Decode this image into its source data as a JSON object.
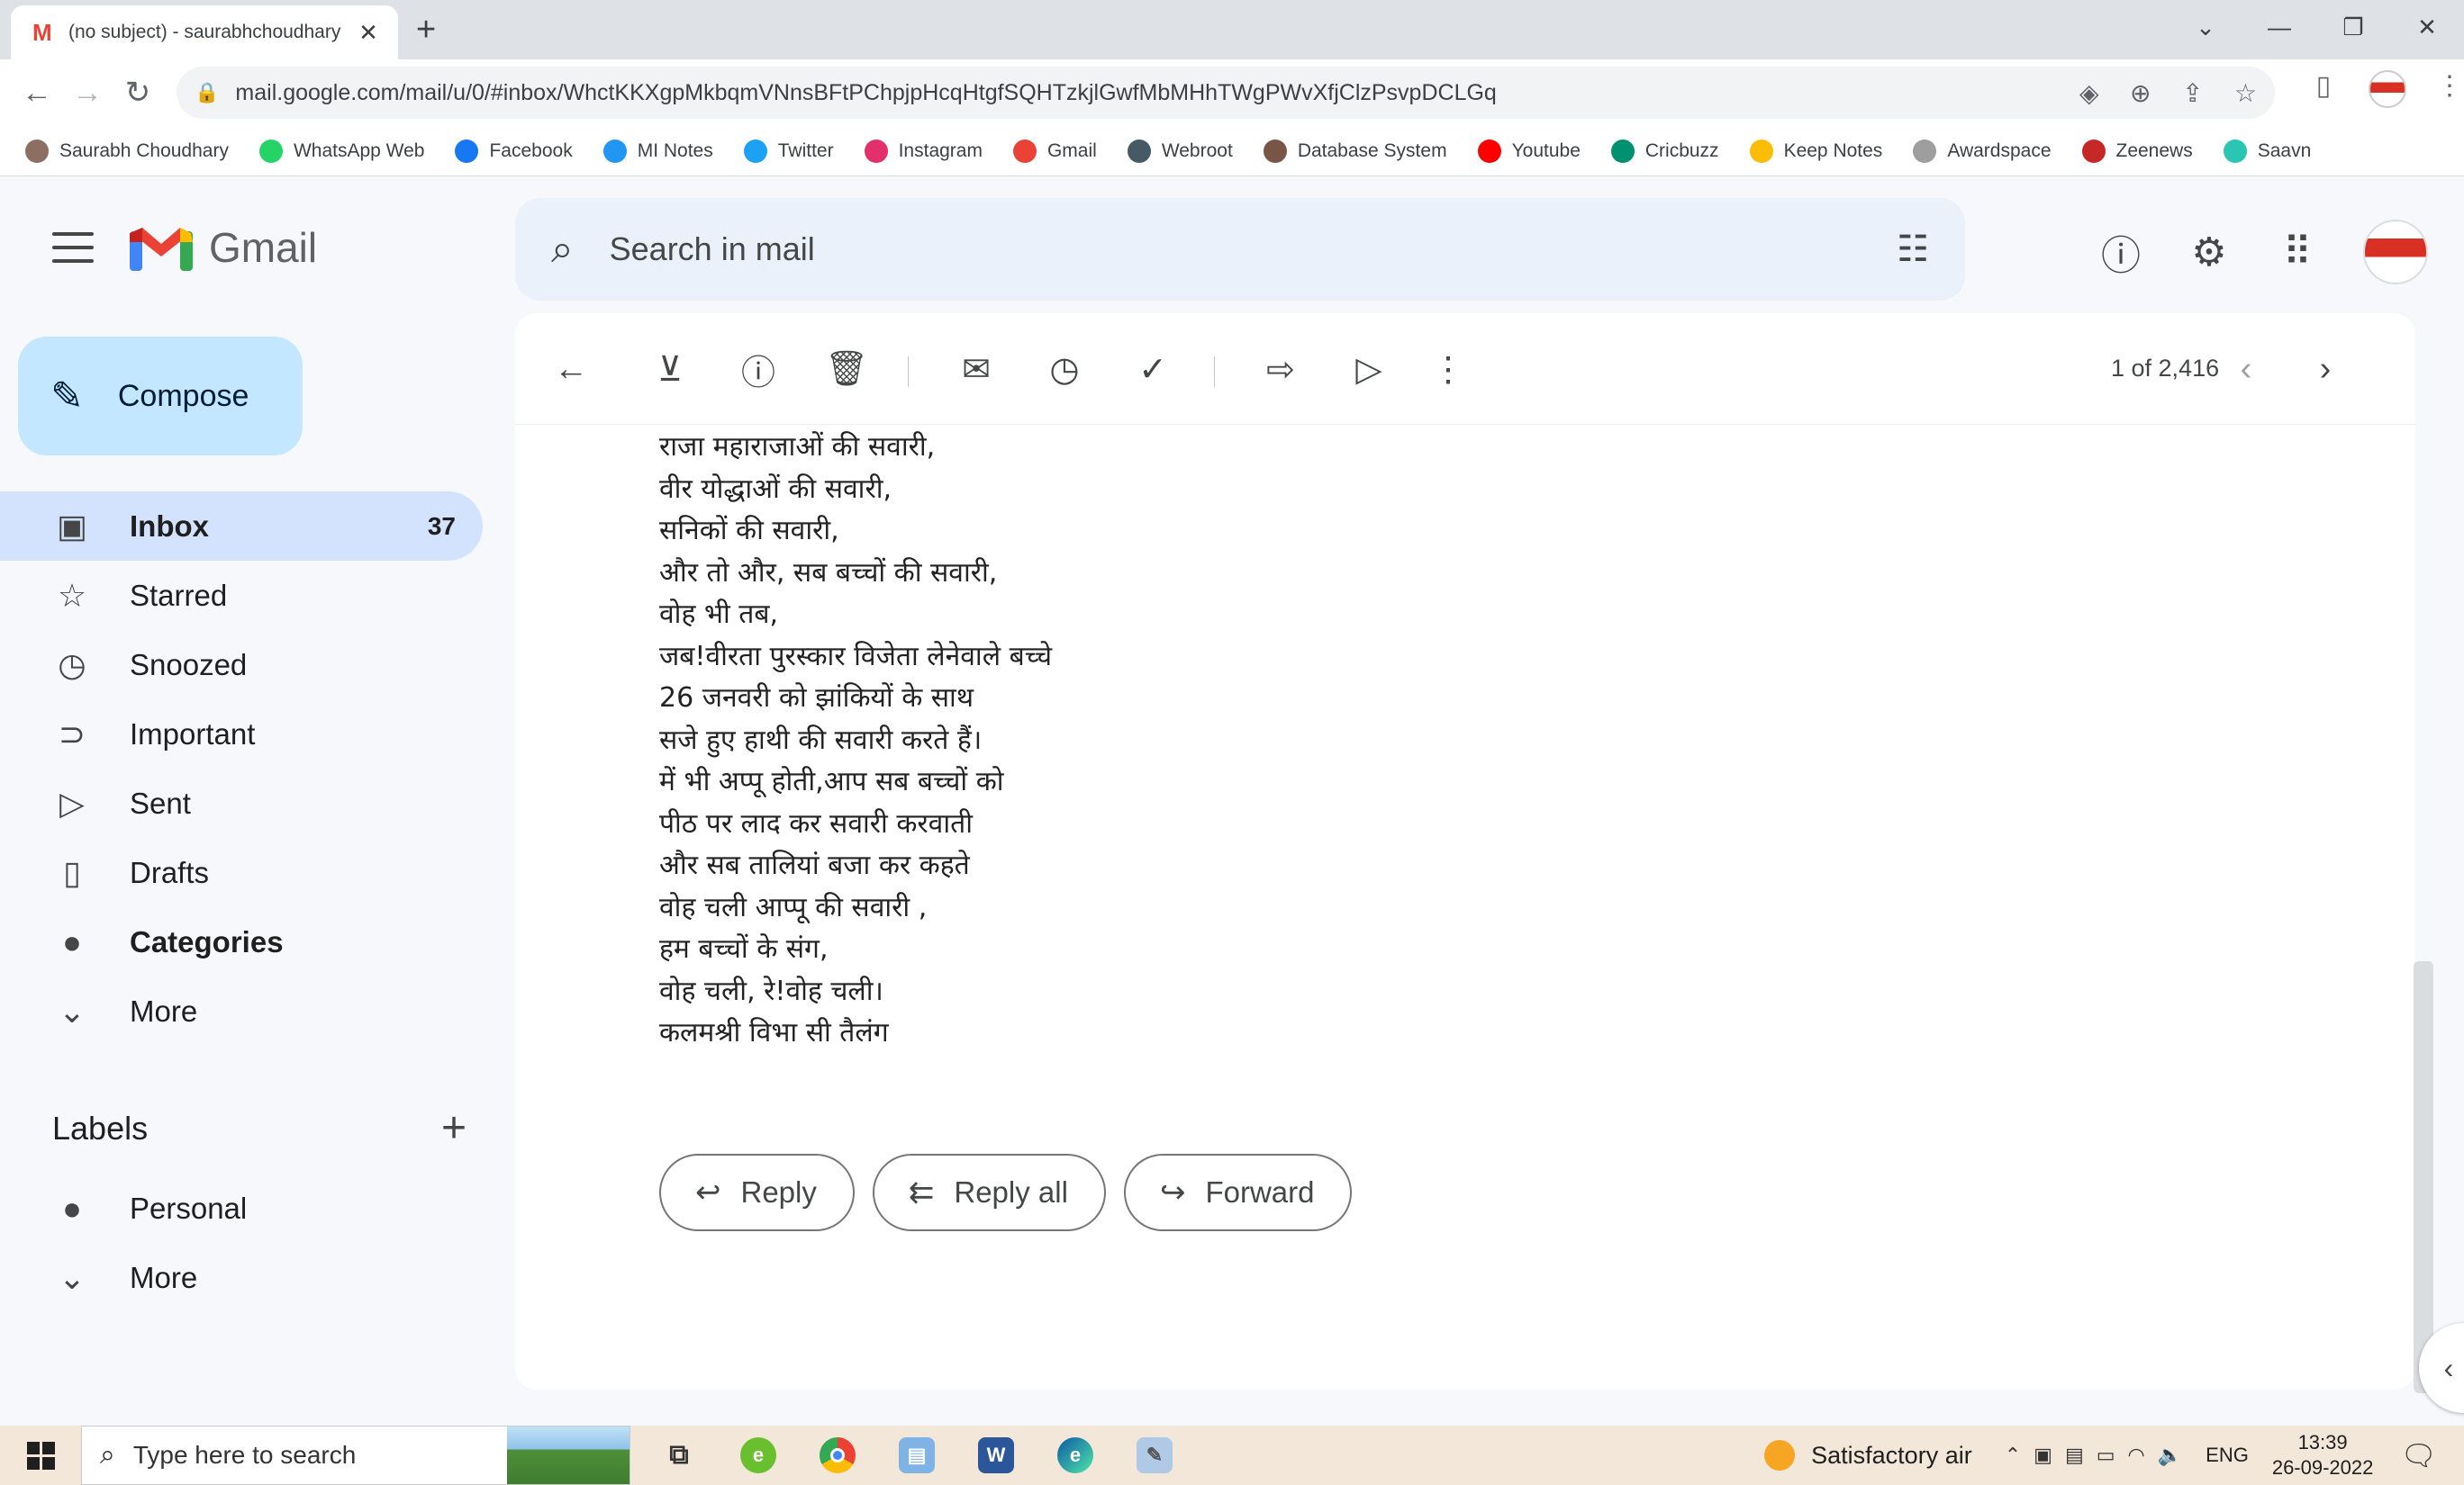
{
  "browser": {
    "tab_title": "(no subject) - saurabhchoudhary",
    "url": "mail.google.com/mail/u/0/#inbox/WhctKKXgpMkbqmVNnsBFtPChpjpHcqHtgfSQHTzkjlGwfMbMHhTWgPWvXfjClzPsvpDCLGq",
    "bookmarks": [
      {
        "label": "Saurabh Choudhary",
        "color": "#8d6e63"
      },
      {
        "label": "WhatsApp Web",
        "color": "#25d366"
      },
      {
        "label": "Facebook",
        "color": "#1877f2"
      },
      {
        "label": "MI Notes",
        "color": "#2196f3"
      },
      {
        "label": "Twitter",
        "color": "#1da1f2"
      },
      {
        "label": "Instagram",
        "color": "#e1306c"
      },
      {
        "label": "Gmail",
        "color": "#ea4335"
      },
      {
        "label": "Webroot",
        "color": "#455a64"
      },
      {
        "label": "Database System",
        "color": "#795548"
      },
      {
        "label": "Youtube",
        "color": "#ff0000"
      },
      {
        "label": "Cricbuzz",
        "color": "#009270"
      },
      {
        "label": "Keep Notes",
        "color": "#fbbc04"
      },
      {
        "label": "Awardspace",
        "color": "#9e9e9e"
      },
      {
        "label": "Zeenews",
        "color": "#c62828"
      },
      {
        "label": "Saavn",
        "color": "#2bc5b4"
      }
    ]
  },
  "gmail": {
    "logo_text": "Gmail",
    "search_placeholder": "Search in mail",
    "compose_label": "Compose",
    "nav": [
      {
        "label": "Inbox",
        "count": "37",
        "icon": "inbox-icon"
      },
      {
        "label": "Starred",
        "count": "",
        "icon": "star-icon"
      },
      {
        "label": "Snoozed",
        "count": "",
        "icon": "clock-icon"
      },
      {
        "label": "Important",
        "count": "",
        "icon": "important-icon"
      },
      {
        "label": "Sent",
        "count": "",
        "icon": "send-icon"
      },
      {
        "label": "Drafts",
        "count": "",
        "icon": "draft-icon"
      },
      {
        "label": "Categories",
        "count": "",
        "icon": "label-icon"
      },
      {
        "label": "More",
        "count": "",
        "icon": "chevron-down-icon"
      }
    ],
    "labels_title": "Labels",
    "labels": [
      {
        "label": "Personal"
      },
      {
        "label": "More"
      }
    ],
    "pager": "1 of 2,416",
    "message_lines": [
      "राजा महाराजाओं की सवारी,",
      "वीर योद्धाओं की सवारी,",
      "सनिकों की सवारी,",
      "और तो और, सब बच्चों की सवारी,",
      "वोह भी तब,",
      "जब!वीरता पुरस्कार विजेता लेनेवाले बच्चे",
      "26 जनवरी को झांकियों  के साथ",
      "सजे हुए हाथी की सवारी करते हैं।",
      "में भी अप्पू होती,आप सब बच्चों को",
      "पीठ पर लाद कर सवारी करवाती",
      "और सब तालियां बजा कर कहते",
      "वोह चली आप्पू की सवारी ,",
      "हम बच्चों के संग,",
      "वोह चली, रे!वोह चली।",
      "कलमश्री विभा सी तैलंग"
    ],
    "actions": {
      "reply": "Reply",
      "reply_all": "Reply all",
      "forward": "Forward"
    }
  },
  "taskbar": {
    "search_placeholder": "Type here to search",
    "weather": "Satisfactory air",
    "lang": "ENG",
    "time": "13:39",
    "date": "26-09-2022"
  }
}
